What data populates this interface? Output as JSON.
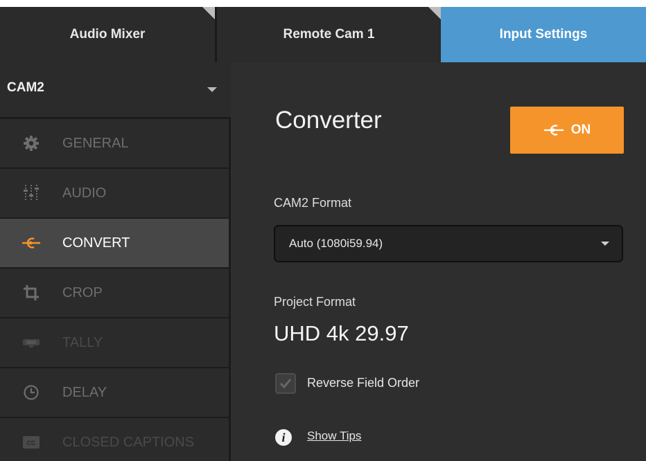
{
  "tabs": [
    {
      "label": "Audio Mixer",
      "active": false
    },
    {
      "label": "Remote Cam 1",
      "active": false
    },
    {
      "label": "Input Settings",
      "active": true
    }
  ],
  "sidebar": {
    "selected_input": "CAM2",
    "items": [
      {
        "label": "GENERAL",
        "icon": "gear-icon",
        "active": false
      },
      {
        "label": "AUDIO",
        "icon": "audio-sliders-icon",
        "active": false
      },
      {
        "label": "CONVERT",
        "icon": "converter-icon",
        "active": true
      },
      {
        "label": "CROP",
        "icon": "crop-icon",
        "active": false
      },
      {
        "label": "TALLY",
        "icon": "tally-icon",
        "active": false
      },
      {
        "label": "DELAY",
        "icon": "clock-icon",
        "active": false
      },
      {
        "label": "CLOSED CAPTIONS",
        "icon": "cc-icon",
        "active": false
      }
    ]
  },
  "main": {
    "title": "Converter",
    "toggle_label": "ON",
    "format_label": "CAM2 Format",
    "format_value": "Auto (1080i59.94)",
    "project_format_label": "Project Format",
    "project_format_value": "UHD 4k 29.97",
    "reverse_field_order_label": "Reverse Field Order",
    "reverse_field_order_checked": true,
    "show_tips_label": "Show Tips"
  },
  "colors": {
    "accent_orange": "#f5942a",
    "tab_active_blue": "#4d99d0",
    "panel_bg": "#2e2e2e",
    "sidebar_item_bg": "#2b2b2b",
    "sidebar_active_bg": "#474747"
  }
}
